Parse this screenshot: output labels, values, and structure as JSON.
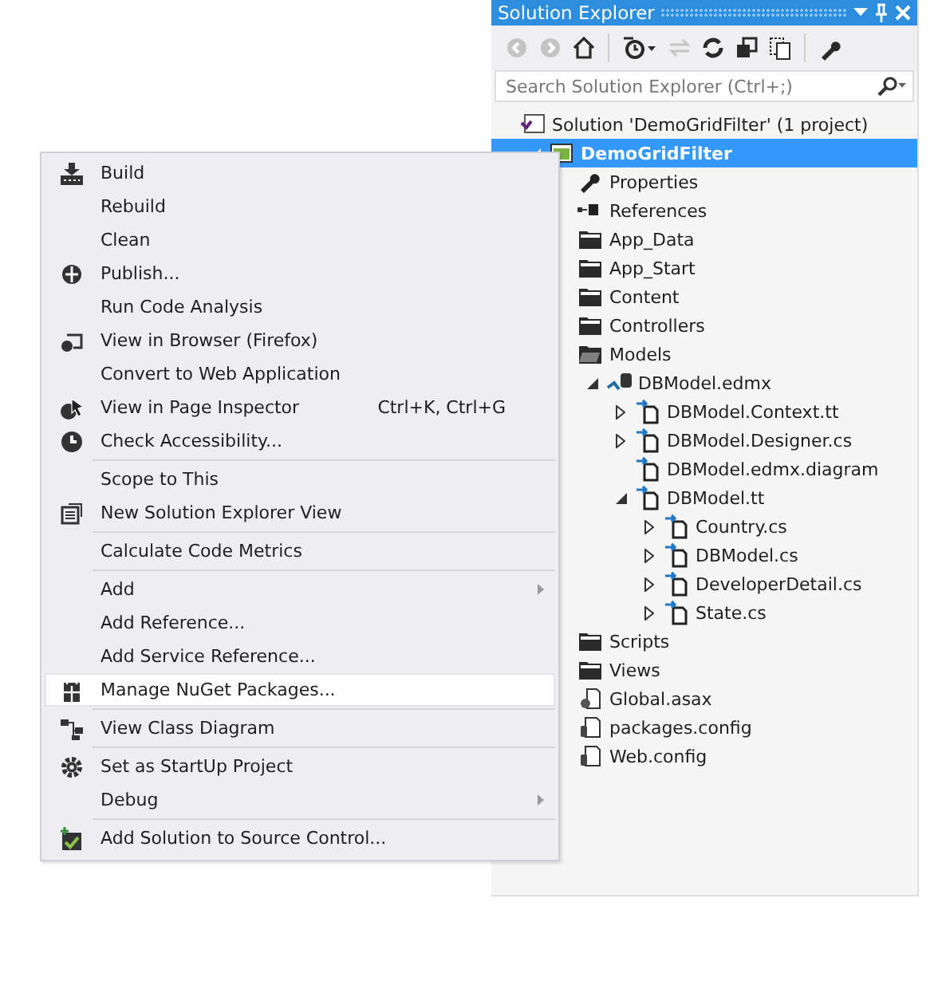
{
  "solution_explorer": {
    "title": "Solution Explorer",
    "search": {
      "placeholder": "Search Solution Explorer (Ctrl+;)"
    },
    "toolbar": [
      {
        "kind": "back",
        "disabled": true
      },
      {
        "kind": "forward",
        "disabled": true
      },
      {
        "kind": "home",
        "disabled": false
      },
      {
        "kind": "sep"
      },
      {
        "kind": "history",
        "disabled": false
      },
      {
        "kind": "sync",
        "disabled": true
      },
      {
        "kind": "refresh",
        "disabled": false
      },
      {
        "kind": "collapse",
        "disabled": false
      },
      {
        "kind": "showall",
        "disabled": false
      },
      {
        "kind": "sep"
      },
      {
        "kind": "properties",
        "disabled": false
      }
    ],
    "tree": [
      {
        "label": "Solution 'DemoGridFilter' (1 project)",
        "kind": "solution",
        "selected": false,
        "children": [
          {
            "label": "DemoGridFilter",
            "kind": "project",
            "selected": true,
            "expanded": true,
            "children": [
              {
                "label": "Properties",
                "kind": "wrench",
                "selected": false
              },
              {
                "label": "References",
                "kind": "references",
                "selected": false
              },
              {
                "label": "App_Data",
                "kind": "folder",
                "selected": false
              },
              {
                "label": "App_Start",
                "kind": "folder",
                "selected": false
              },
              {
                "label": "Content",
                "kind": "folder",
                "selected": false
              },
              {
                "label": "Controllers",
                "kind": "folder",
                "selected": false
              },
              {
                "label": "Models",
                "kind": "openfolder",
                "selected": false,
                "children": [
                  {
                    "label": "DBModel.edmx",
                    "kind": "edmx",
                    "selected": false,
                    "expanded": true,
                    "children": [
                      {
                        "label": "DBModel.Context.tt",
                        "kind": "file",
                        "selected": false,
                        "expanded": false
                      },
                      {
                        "label": "DBModel.Designer.cs",
                        "kind": "file",
                        "selected": false,
                        "expanded": false
                      },
                      {
                        "label": "DBModel.edmx.diagram",
                        "kind": "file",
                        "selected": false
                      },
                      {
                        "label": "DBModel.tt",
                        "kind": "file",
                        "selected": false,
                        "expanded": true,
                        "children": [
                          {
                            "label": "Country.cs",
                            "kind": "file",
                            "selected": false,
                            "expanded": false
                          },
                          {
                            "label": "DBModel.cs",
                            "kind": "file",
                            "selected": false,
                            "expanded": false
                          },
                          {
                            "label": "DeveloperDetail.cs",
                            "kind": "file",
                            "selected": false,
                            "expanded": false
                          },
                          {
                            "label": "State.cs",
                            "kind": "file",
                            "selected": false,
                            "expanded": false
                          }
                        ]
                      }
                    ]
                  }
                ]
              },
              {
                "label": "Scripts",
                "kind": "folder",
                "selected": false
              },
              {
                "label": "Views",
                "kind": "folder",
                "selected": false
              },
              {
                "label": "Global.asax",
                "kind": "asax",
                "selected": false
              },
              {
                "label": "packages.config",
                "kind": "config",
                "selected": false
              },
              {
                "label": "Web.config",
                "kind": "config",
                "selected": false
              }
            ]
          }
        ]
      }
    ]
  },
  "context_menu": [
    {
      "kind": "build",
      "label": "Build",
      "selected": false,
      "submenu": false
    },
    {
      "kind": "plain",
      "label": "Rebuild",
      "selected": false,
      "submenu": false
    },
    {
      "kind": "plain",
      "label": "Clean",
      "selected": false,
      "submenu": false
    },
    {
      "kind": "publish",
      "label": "Publish...",
      "selected": false,
      "submenu": false
    },
    {
      "kind": "plain",
      "label": "Run Code Analysis",
      "selected": false,
      "submenu": false
    },
    {
      "kind": "browser",
      "label": "View in Browser (Firefox)",
      "selected": false,
      "submenu": false
    },
    {
      "kind": "plain",
      "label": "Convert to Web Application",
      "selected": false,
      "submenu": false
    },
    {
      "kind": "inspector",
      "label": "View in Page Inspector",
      "shortcut": "Ctrl+K, Ctrl+G",
      "selected": false,
      "submenu": false
    },
    {
      "kind": "accessibility",
      "label": "Check Accessibility...",
      "selected": false,
      "submenu": false
    },
    {
      "kind": "separator"
    },
    {
      "kind": "plain",
      "label": "Scope to This",
      "selected": false,
      "submenu": false
    },
    {
      "kind": "explorerview",
      "label": "New Solution Explorer View",
      "selected": false,
      "submenu": false
    },
    {
      "kind": "separator"
    },
    {
      "kind": "plain",
      "label": "Calculate Code Metrics",
      "selected": false,
      "submenu": false
    },
    {
      "kind": "separator"
    },
    {
      "kind": "plain",
      "label": "Add",
      "selected": false,
      "submenu": true
    },
    {
      "kind": "plain",
      "label": "Add Reference...",
      "selected": false,
      "submenu": false
    },
    {
      "kind": "plain",
      "label": "Add Service Reference...",
      "selected": false,
      "submenu": false
    },
    {
      "kind": "nuget",
      "label": "Manage NuGet Packages...",
      "selected": true,
      "submenu": false
    },
    {
      "kind": "separator"
    },
    {
      "kind": "classdiagram",
      "label": "View Class Diagram",
      "selected": false,
      "submenu": false
    },
    {
      "kind": "separator"
    },
    {
      "kind": "gear",
      "label": "Set as StartUp Project",
      "selected": false,
      "submenu": false
    },
    {
      "kind": "plain",
      "label": "Debug",
      "selected": false,
      "submenu": true
    },
    {
      "kind": "separator"
    },
    {
      "kind": "sourcecontrol",
      "label": "Add Solution to Source Control...",
      "selected": false,
      "submenu": false
    }
  ]
}
